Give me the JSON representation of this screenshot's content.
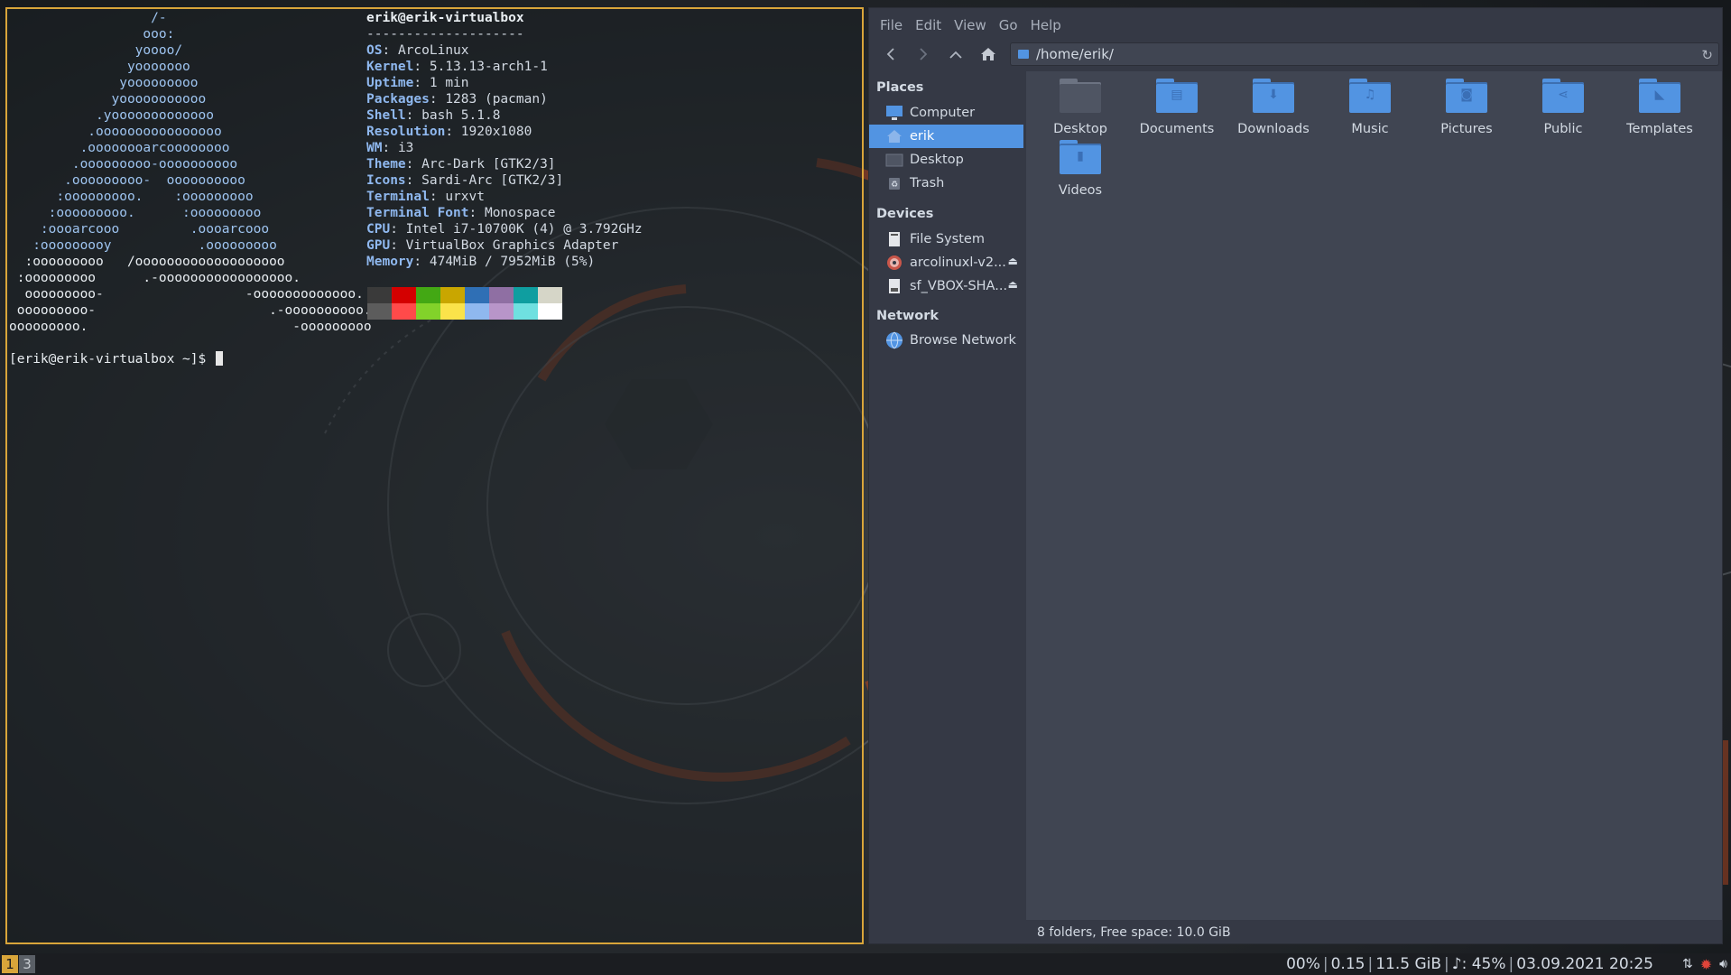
{
  "terminal": {
    "ascii_art": [
      "                  /-",
      "                 ooo:",
      "                yoooo/",
      "               yooooooo",
      "              yooooooooo",
      "             yooooooooooo",
      "           .yooooooooooooo",
      "          .oooooooooooooooo",
      "         .oooooooarcoooooooo",
      "        .ooooooooo-oooooooooo",
      "       .ooooooooo-  oooooooooo",
      "      :ooooooooo.    :ooooooooo",
      "     :ooooooooo.      :ooooooooo",
      "    :oooarcooo         .oooarcooo",
      "   :ooooooooy           .ooooooooo",
      "  :ooooooooo   /ooooooooooooooooooo",
      " :ooooooooo      .-ooooooooooooooooo.",
      "  ooooooooo-                  -ooooooooooooo.",
      " ooooooooo-                      .-oooooooooo.",
      "ooooooooo.                          -ooooooooo"
    ],
    "userhost": "erik@erik-virtualbox",
    "separator": "--------------------",
    "info": [
      {
        "key": "OS",
        "value": "ArcoLinux"
      },
      {
        "key": "Kernel",
        "value": "5.13.13-arch1-1"
      },
      {
        "key": "Uptime",
        "value": "1 min"
      },
      {
        "key": "Packages",
        "value": "1283 (pacman)"
      },
      {
        "key": "Shell",
        "value": "bash 5.1.8"
      },
      {
        "key": "Resolution",
        "value": "1920x1080"
      },
      {
        "key": "WM",
        "value": "i3"
      },
      {
        "key": "Theme",
        "value": "Arc-Dark [GTK2/3]"
      },
      {
        "key": "Icons",
        "value": "Sardi-Arc [GTK2/3]"
      },
      {
        "key": "Terminal",
        "value": "urxvt"
      },
      {
        "key": "Terminal Font",
        "value": "Monospace"
      },
      {
        "key": "CPU",
        "value": "Intel i7-10700K (4) @ 3.792GHz"
      },
      {
        "key": "GPU",
        "value": "VirtualBox Graphics Adapter"
      },
      {
        "key": "Memory",
        "value": "474MiB / 7952MiB (5%)"
      }
    ],
    "palette_colors": [
      "#3a3a3a",
      "#d40000",
      "#43a814",
      "#c9a600",
      "#2f6fb5",
      "#8f6fa3",
      "#0f9ea0",
      "#d6d6c8",
      "#5c5c5c",
      "#ff4a4a",
      "#82d22a",
      "#fbe34a",
      "#8fb8ef",
      "#b895c9",
      "#6fe0e0",
      "#ffffff"
    ],
    "prompt": "[erik@erik-virtualbox ~]$ "
  },
  "filemanager": {
    "menu": [
      "File",
      "Edit",
      "View",
      "Go",
      "Help"
    ],
    "location": "/home/erik/",
    "sidebar": {
      "places_heading": "Places",
      "places": [
        {
          "label": "Computer",
          "icon": "computer-icon"
        },
        {
          "label": "erik",
          "icon": "home-icon",
          "selected": true
        },
        {
          "label": "Desktop",
          "icon": "desktop-folder-icon"
        },
        {
          "label": "Trash",
          "icon": "trash-icon"
        }
      ],
      "devices_heading": "Devices",
      "devices": [
        {
          "label": "File System",
          "icon": "drive-icon"
        },
        {
          "label": "arcolinuxl-v2...",
          "icon": "optical-disc-icon",
          "eject": true
        },
        {
          "label": "sf_VBOX-SHA...",
          "icon": "shared-drive-icon",
          "eject": true
        }
      ],
      "network_heading": "Network",
      "network": [
        {
          "label": "Browse Network",
          "icon": "network-globe-icon"
        }
      ]
    },
    "folders": [
      {
        "label": "Desktop",
        "icon": "desktop-folder-icon"
      },
      {
        "label": "Documents",
        "icon": "documents-folder-icon"
      },
      {
        "label": "Downloads",
        "icon": "downloads-folder-icon"
      },
      {
        "label": "Music",
        "icon": "music-folder-icon"
      },
      {
        "label": "Pictures",
        "icon": "pictures-folder-icon"
      },
      {
        "label": "Public",
        "icon": "public-folder-icon"
      },
      {
        "label": "Templates",
        "icon": "templates-folder-icon"
      },
      {
        "label": "Videos",
        "icon": "videos-folder-icon"
      }
    ],
    "status": "8 folders, Free space: 10.0 GiB"
  },
  "i3bar": {
    "workspaces": [
      "1",
      "3"
    ],
    "active_workspace": "1",
    "status": [
      "00%",
      "0.15",
      "11.5 GiB",
      "♪: 45%",
      "03.09.2021 20:25"
    ]
  },
  "colors": {
    "accent": "#5294e2",
    "terminal_border": "#d9a53a",
    "wallpaper_orange": "#b2451f"
  }
}
